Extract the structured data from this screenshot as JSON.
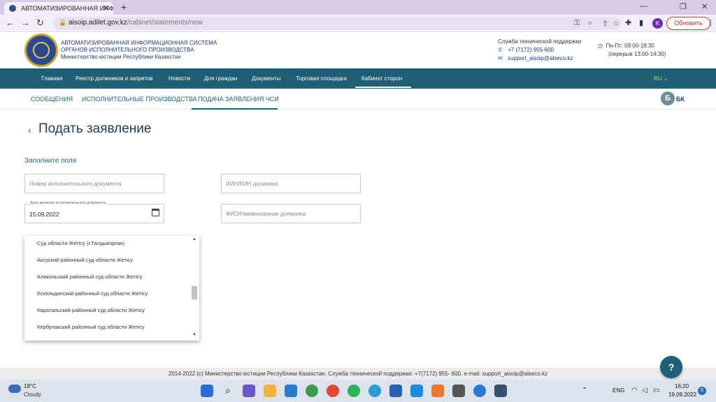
{
  "browser": {
    "tab_title": "АВТОМАТИЗИРОВАННАЯ ИНФОРМ...",
    "new_tab_symbol": "+",
    "url_host": "aisoip.adilet.gov.kz",
    "url_path": "/cabinet/statements/new",
    "profile_initial": "K",
    "update_button": "Обновить"
  },
  "header": {
    "org_line1": "АВТОМАТИЗИРОВАННАЯ ИНФОРМАЦИОННАЯ СИСТЕМА",
    "org_line2": "ОРГАНОВ ИСПОЛНИТЕЛЬНОГО ПРОИЗВОДСТВА",
    "org_line3": "Министерство юстиции Республики Казахстан",
    "support_title": "Служба технической поддержки",
    "support_phone": "+7 (7172) 955-600",
    "support_email": "support_aisoip@alseco.kz",
    "hours_line1": "Пн-Пт: 09:00-18:30",
    "hours_line2": "(перерыв 13:00-14:30)"
  },
  "main_nav": {
    "items": [
      "Главная",
      "Реестр должников и запретов",
      "Новости",
      "Для граждан",
      "Документы",
      "Торговая площадка",
      "Кабинет сторон"
    ],
    "active": "Кабинет сторон",
    "language": "RU"
  },
  "sub_nav": {
    "items": [
      "СООБЩЕНИЯ",
      "ИСПОЛНИТЕЛЬНЫЕ ПРОИЗВОДСТВА",
      "ПОДАЧА ЗАЯВЛЕНИЯ ЧСИ"
    ],
    "active": "ПОДАЧА ЗАЯВЛЕНИЯ ЧСИ",
    "user_badge": "Б",
    "user_initials": "БК"
  },
  "page": {
    "title": "Подать заявление",
    "section_label": "Заполните поля"
  },
  "form": {
    "doc_number_placeholder": "Номер исполнительного документа",
    "iin_placeholder": "ИИН/БИН должника",
    "date_label": "Дата выписки исполнительного документа",
    "date_value": "15.09.2022",
    "debtor_name_placeholder": "ФИО/Наименование должника"
  },
  "dropdown": {
    "items": [
      "Суд области Жетісу (г.Талдыкорган)",
      "Аксуский районный суд области Жетісу",
      "Алакольский районный суд области Жетісу",
      "Ескельдинский районный суд области Жетісу",
      "Каратальский районный суд области Жетісу",
      "Кербулакский районный суд области Жетісу"
    ]
  },
  "footer": {
    "text": "2014-2022 (c) Министерство юстиции Республики Казахстан. Служба технической поддержки: +7(7172) 955- 600, e-mail: support_aisoip@alseco.kz",
    "help_label": "?"
  },
  "taskbar": {
    "temperature": "19°C",
    "weather": "Cloudy",
    "language": "ENG",
    "time": "16:20",
    "date": "19.09.2022",
    "notifications": "5"
  },
  "colors": {
    "nav_bg": "#1f5f75",
    "accent_link": "#1f5f75",
    "lang_accent": "#f5c542",
    "update_border": "#c0392b"
  },
  "icons": [
    "back-arrow-icon",
    "forward-arrow-icon",
    "reload-icon",
    "lock-icon",
    "key-icon",
    "zoom-icon",
    "share-icon",
    "star-icon",
    "extensions-icon",
    "sidebar-icon",
    "menu-dots-icon",
    "phone-icon",
    "mail-icon",
    "clock-icon",
    "calendar-icon",
    "chevron-left-icon",
    "windows-start-icon",
    "search-icon",
    "wifi-icon",
    "volume-icon",
    "battery-icon"
  ]
}
